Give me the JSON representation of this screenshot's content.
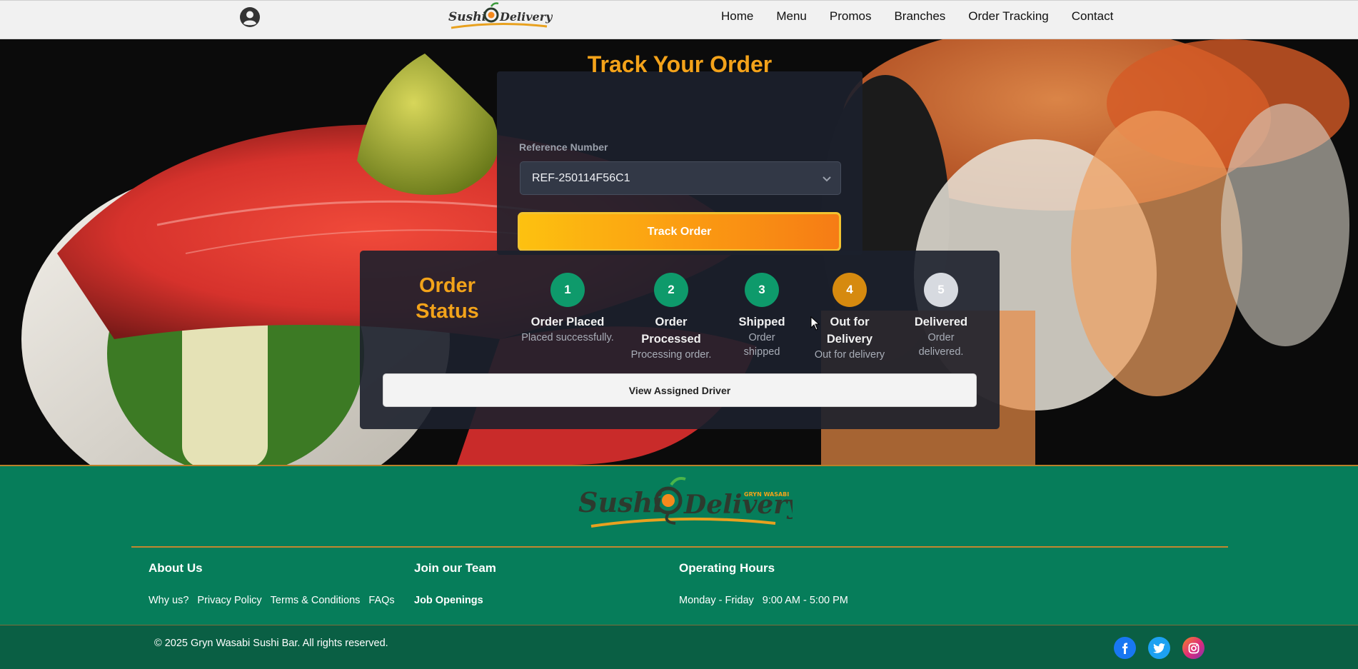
{
  "brand": {
    "logo_text": "Sushi Delivery",
    "logo_tagline": "GRYN WASABI"
  },
  "nav": {
    "items": [
      {
        "label": "Home",
        "name": "nav-home"
      },
      {
        "label": "Menu",
        "name": "nav-menu"
      },
      {
        "label": "Promos",
        "name": "nav-promos"
      },
      {
        "label": "Branches",
        "name": "nav-branches"
      },
      {
        "label": "Order Tracking",
        "name": "nav-order-tracking"
      },
      {
        "label": "Contact",
        "name": "nav-contact"
      }
    ]
  },
  "tracker": {
    "title": "Track Your Order",
    "reference_label": "Reference Number",
    "reference_value": "REF-250114F56C1",
    "track_button": "Track Order"
  },
  "order_status": {
    "title": "Order Status",
    "steps": [
      {
        "number": "1",
        "label": "Order Placed",
        "desc": "Placed successfully.",
        "state": "complete",
        "color": "#0e9a6b"
      },
      {
        "number": "2",
        "label": "Order Processed",
        "desc": "Processing order.",
        "state": "complete",
        "color": "#0e9a6b"
      },
      {
        "number": "3",
        "label": "Shipped",
        "desc": "Order shipped",
        "state": "complete",
        "color": "#0e9a6b"
      },
      {
        "number": "4",
        "label": "Out for Delivery",
        "desc": "Out for delivery",
        "state": "current",
        "color": "#d68a0f"
      },
      {
        "number": "5",
        "label": "Delivered",
        "desc": "Order delivered.",
        "state": "pending",
        "color": "#d7dae0"
      }
    ],
    "driver_button": "View Assigned Driver"
  },
  "footer": {
    "about": {
      "heading": "About Us",
      "links": [
        "Why us?",
        "Privacy Policy",
        "Terms & Conditions",
        "FAQs"
      ]
    },
    "team": {
      "heading": "Join our Team",
      "link": "Job Openings"
    },
    "hours": {
      "heading": "Operating Hours",
      "days": "Monday - Friday",
      "time": "9:00 AM - 5:00 PM"
    },
    "copyright": "© 2025 Gryn Wasabi Sushi Bar. All rights reserved.",
    "socials": [
      {
        "name": "facebook-icon",
        "color": "#1877f2"
      },
      {
        "name": "twitter-icon",
        "color": "#1da1f2"
      },
      {
        "name": "instagram-icon",
        "color": "#d62976"
      }
    ]
  },
  "colors": {
    "accent_orange": "#f2a31a",
    "footer_green": "#067d5a",
    "step_done": "#0e9a6b",
    "step_current": "#d68a0f"
  }
}
